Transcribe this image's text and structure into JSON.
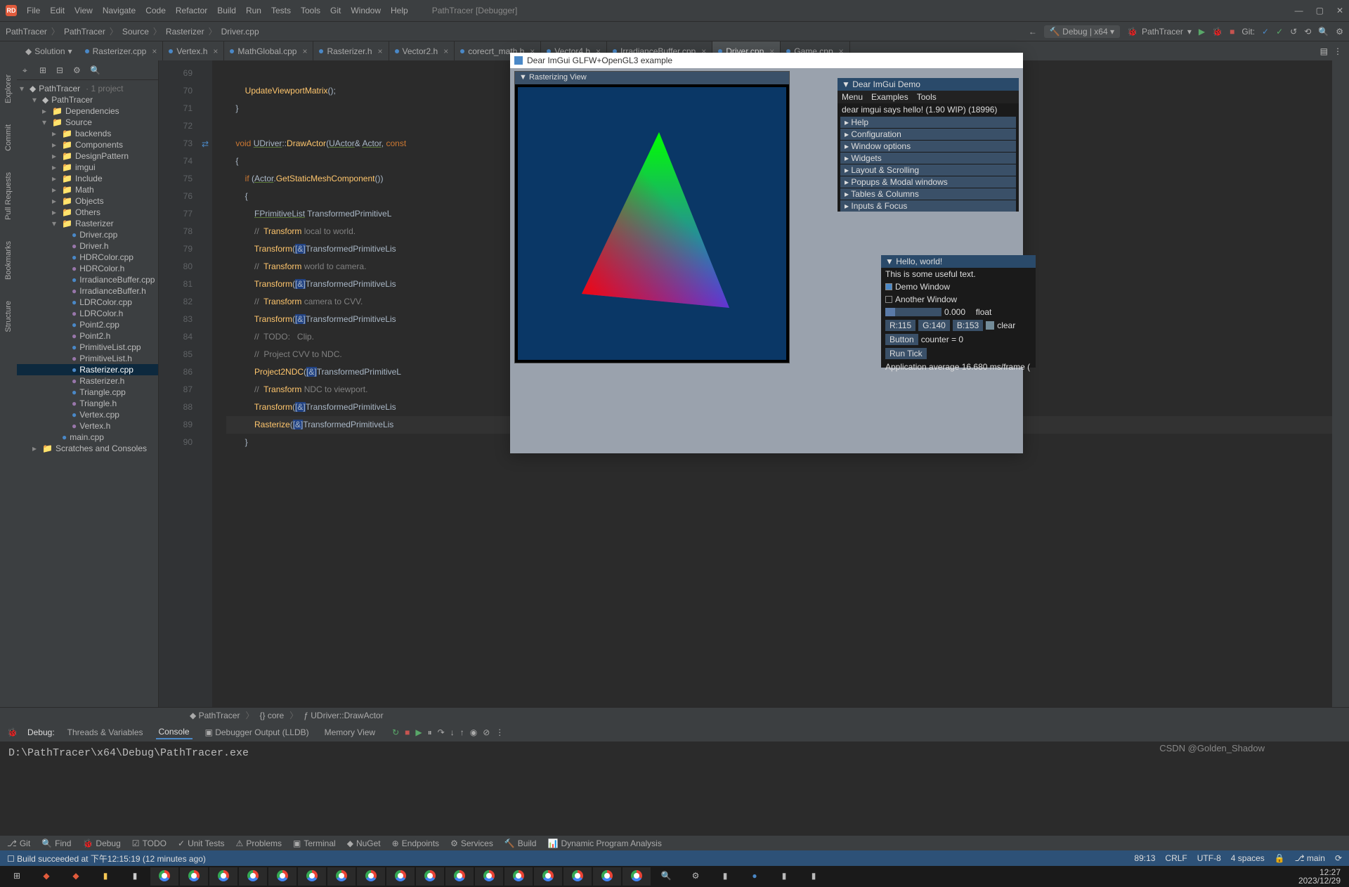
{
  "app": {
    "name": "RD",
    "title": "PathTracer [Debugger]"
  },
  "menu": [
    "File",
    "Edit",
    "View",
    "Navigate",
    "Code",
    "Refactor",
    "Build",
    "Run",
    "Tests",
    "Tools",
    "Git",
    "Window",
    "Help"
  ],
  "breadcrumbs": [
    "PathTracer",
    "PathTracer",
    "Source",
    "Rasterizer",
    "Driver.cpp"
  ],
  "run": {
    "config": "Debug | x64",
    "target": "PathTracer",
    "git_label": "Git:"
  },
  "solution_label": "Solution",
  "tabs": [
    {
      "name": "Rasterizer.cpp",
      "active": false
    },
    {
      "name": "Vertex.h",
      "active": false
    },
    {
      "name": "MathGlobal.cpp",
      "active": false
    },
    {
      "name": "Rasterizer.h",
      "active": false
    },
    {
      "name": "Vector2.h",
      "active": false
    },
    {
      "name": "corecrt_math.h",
      "active": false
    },
    {
      "name": "Vector4.h",
      "active": false
    },
    {
      "name": "IrradianceBuffer.cpp",
      "active": false
    },
    {
      "name": "Driver.cpp",
      "active": true
    },
    {
      "name": "Game.cpp",
      "active": false
    }
  ],
  "leftrail": [
    "Explorer",
    "Commit",
    "Pull Requests",
    "Bookmarks",
    "Structure"
  ],
  "tree": {
    "root": {
      "name": "PathTracer",
      "suffix": "· 1 project"
    },
    "items": [
      {
        "d": 1,
        "c": "v",
        "n": "PathTracer",
        "t": "proj"
      },
      {
        "d": 2,
        "c": ">",
        "n": "Dependencies",
        "t": "fld"
      },
      {
        "d": 2,
        "c": "v",
        "n": "Source",
        "t": "fld"
      },
      {
        "d": 3,
        "c": ">",
        "n": "backends",
        "t": "fld"
      },
      {
        "d": 3,
        "c": ">",
        "n": "Components",
        "t": "fld"
      },
      {
        "d": 3,
        "c": ">",
        "n": "DesignPattern",
        "t": "fld"
      },
      {
        "d": 3,
        "c": ">",
        "n": "imgui",
        "t": "fld"
      },
      {
        "d": 3,
        "c": ">",
        "n": "Include",
        "t": "fld"
      },
      {
        "d": 3,
        "c": ">",
        "n": "Math",
        "t": "fld"
      },
      {
        "d": 3,
        "c": ">",
        "n": "Objects",
        "t": "fld"
      },
      {
        "d": 3,
        "c": ">",
        "n": "Others",
        "t": "fld"
      },
      {
        "d": 3,
        "c": "v",
        "n": "Rasterizer",
        "t": "fld"
      },
      {
        "d": 4,
        "c": "",
        "n": "Driver.cpp",
        "t": "cpp"
      },
      {
        "d": 4,
        "c": "",
        "n": "Driver.h",
        "t": "h"
      },
      {
        "d": 4,
        "c": "",
        "n": "HDRColor.cpp",
        "t": "cpp"
      },
      {
        "d": 4,
        "c": "",
        "n": "HDRColor.h",
        "t": "h"
      },
      {
        "d": 4,
        "c": "",
        "n": "IrradianceBuffer.cpp",
        "t": "cpp"
      },
      {
        "d": 4,
        "c": "",
        "n": "IrradianceBuffer.h",
        "t": "h"
      },
      {
        "d": 4,
        "c": "",
        "n": "LDRColor.cpp",
        "t": "cpp"
      },
      {
        "d": 4,
        "c": "",
        "n": "LDRColor.h",
        "t": "h"
      },
      {
        "d": 4,
        "c": "",
        "n": "Point2.cpp",
        "t": "cpp"
      },
      {
        "d": 4,
        "c": "",
        "n": "Point2.h",
        "t": "h"
      },
      {
        "d": 4,
        "c": "",
        "n": "PrimitiveList.cpp",
        "t": "cpp"
      },
      {
        "d": 4,
        "c": "",
        "n": "PrimitiveList.h",
        "t": "h"
      },
      {
        "d": 4,
        "c": "",
        "n": "Rasterizer.cpp",
        "t": "cpp",
        "sel": true
      },
      {
        "d": 4,
        "c": "",
        "n": "Rasterizer.h",
        "t": "h"
      },
      {
        "d": 4,
        "c": "",
        "n": "Triangle.cpp",
        "t": "cpp"
      },
      {
        "d": 4,
        "c": "",
        "n": "Triangle.h",
        "t": "h"
      },
      {
        "d": 4,
        "c": "",
        "n": "Vertex.cpp",
        "t": "cpp"
      },
      {
        "d": 4,
        "c": "",
        "n": "Vertex.h",
        "t": "h"
      },
      {
        "d": 3,
        "c": "",
        "n": "main.cpp",
        "t": "cpp"
      },
      {
        "d": 1,
        "c": ">",
        "n": "Scratches and Consoles",
        "t": "fld"
      }
    ]
  },
  "code": {
    "start": 69,
    "lines": [
      "",
      "        UpdateViewportMatrix();",
      "    }",
      "",
      "    void UDriver::DrawActor(UActor& Actor, const",
      "    {",
      "        if (Actor.GetStaticMeshComponent())",
      "        {",
      "            FPrimitiveList TransformedPrimitiveL",
      "            //  Transform local to world.",
      "            Transform([&]TransformedPrimitiveLis",
      "            //  Transform world to camera.",
      "            Transform([&]TransformedPrimitiveLis",
      "            //  Transform camera to CVV.",
      "            Transform([&]TransformedPrimitiveLis",
      "            //  TODO:   Clip.",
      "            //  Project CVV to NDC.",
      "            Project2NDC([&]TransformedPrimitiveL",
      "            //  Transform NDC to viewport.",
      "            Transform([&]TransformedPrimitiveLis",
      "            Rasterize([&]TransformedPrimitiveLis",
      "        }"
    ]
  },
  "editor_breadcrumb": [
    "PathTracer",
    "{} core",
    "UDriver::DrawActor"
  ],
  "debug": {
    "label": "Debug:",
    "tabs": [
      "Threads & Variables",
      "Console",
      "Debugger Output (LLDB)",
      "Memory View"
    ],
    "active": "Console",
    "output": "D:\\PathTracer\\x64\\Debug\\PathTracer.exe"
  },
  "bottom_tools": [
    "Git",
    "Find",
    "Debug",
    "TODO",
    "Unit Tests",
    "Problems",
    "Terminal",
    "NuGet",
    "Endpoints",
    "Services",
    "Build",
    "Dynamic Program Analysis"
  ],
  "status": {
    "msg": "Build succeeded at 下午12:15:19  (12 minutes ago)",
    "pos": "89:13",
    "eol": "CRLF",
    "enc": "UTF-8",
    "indent": "4 spaces",
    "branch": "main"
  },
  "gl": {
    "title": "Dear ImGui GLFW+OpenGL3 example",
    "rast_title": "▼ Rasterizing View",
    "demo": {
      "title": "▼ Dear ImGui Demo",
      "menu": [
        "Menu",
        "Examples",
        "Tools"
      ],
      "hello": "dear imgui says hello! (1.90 WIP) (18996)",
      "sections": [
        "Help",
        "Configuration",
        "Window options",
        "Widgets",
        "Layout & Scrolling",
        "Popups & Modal windows",
        "Tables & Columns",
        "Inputs & Focus"
      ]
    },
    "hello": {
      "title": "▼ Hello, world!",
      "text": "This is some useful text.",
      "chk1": "Demo Window",
      "chk2": "Another Window",
      "slider_val": "0.000",
      "slider_lbl": "float",
      "rgb": [
        "R:115",
        "G:140",
        "B:153"
      ],
      "clear": "clear",
      "btn": "Button",
      "counter": "counter = 0",
      "run": "Run Tick",
      "fps": "Application average 16.680 ms/frame ("
    }
  },
  "taskbar": {
    "time": "12:27",
    "date": "2023/12/29",
    "watermark": "CSDN @Golden_Shadow"
  }
}
